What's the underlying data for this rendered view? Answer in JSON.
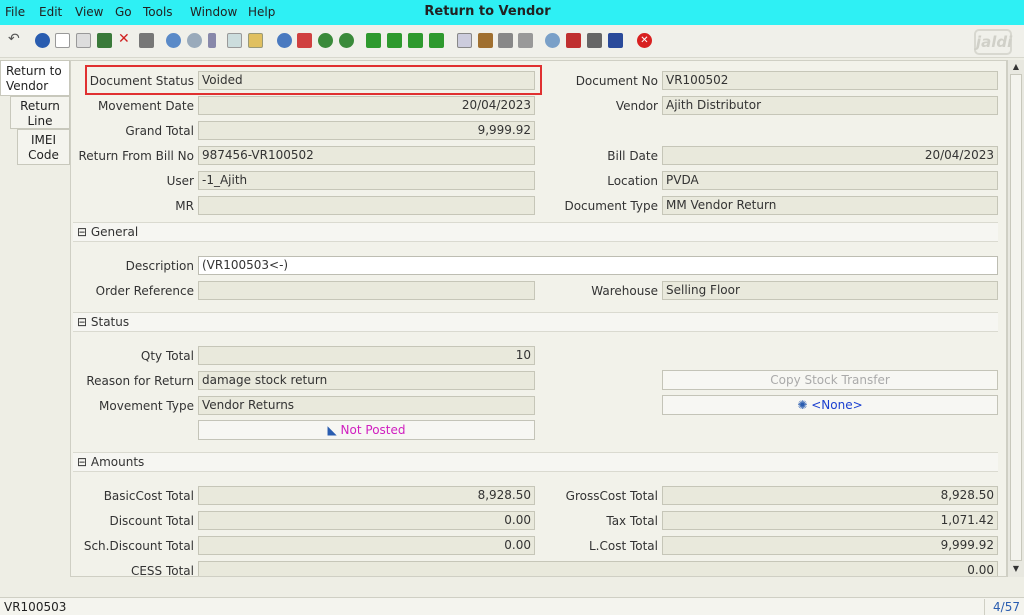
{
  "menu": {
    "file": "File",
    "edit": "Edit",
    "view": "View",
    "go": "Go",
    "tools": "Tools",
    "window": "Window",
    "help": "Help"
  },
  "window_title": "Return to Vendor",
  "logo_text": "jaldi",
  "side_tabs": [
    "Return to Vendor",
    "Return Line",
    "IMEI Code"
  ],
  "header": {
    "document_status_label": "Document Status",
    "document_status": "Voided",
    "document_no_label": "Document No",
    "document_no": "VR100502",
    "movement_date_label": "Movement Date",
    "movement_date": "20/04/2023",
    "vendor_label": "Vendor",
    "vendor": "Ajith Distributor",
    "grand_total_label": "Grand Total",
    "grand_total": "9,999.92",
    "return_bill_label": "Return From Bill No",
    "return_bill": "987456-VR100502",
    "bill_date_label": "Bill Date",
    "bill_date": "20/04/2023",
    "user_label": "User",
    "user": "-1_Ajith",
    "location_label": "Location",
    "location": "PVDA",
    "mr_label": "MR",
    "mr": "",
    "document_type_label": "Document Type",
    "document_type": "MM Vendor Return"
  },
  "general": {
    "section": "General",
    "description_label": "Description",
    "description": "(VR100503<-)",
    "order_ref_label": "Order Reference",
    "order_ref": "",
    "warehouse_label": "Warehouse",
    "warehouse": "Selling Floor"
  },
  "status": {
    "section": "Status",
    "qty_total_label": "Qty Total",
    "qty_total": "10",
    "reason_label": "Reason for Return",
    "reason": "damage stock return",
    "movement_type_label": "Movement Type",
    "movement_type": "Vendor Returns",
    "copy_stock_button": "Copy Stock Transfer",
    "none_button": "<None>",
    "posted_button": "Not Posted"
  },
  "amounts": {
    "section": "Amounts",
    "basic_cost_label": "BasicCost Total",
    "basic_cost": "8,928.50",
    "gross_cost_label": "GrossCost Total",
    "gross_cost": "8,928.50",
    "discount_label": "Discount Total",
    "discount": "0.00",
    "tax_label": "Tax Total",
    "tax": "1,071.42",
    "sch_discount_label": "Sch.Discount Total",
    "sch_discount": "0.00",
    "lcost_label": "L.Cost Total",
    "lcost": "9,999.92",
    "cess_label": "CESS Total",
    "cess": "0.00"
  },
  "statusbar": {
    "left": "VR100503",
    "right": "4/57"
  },
  "colors": {
    "menubar": "#2ef0f4",
    "highlight": "#e03030",
    "magenta_text": "#d020c0",
    "blue_text": "#1a3fd0"
  }
}
